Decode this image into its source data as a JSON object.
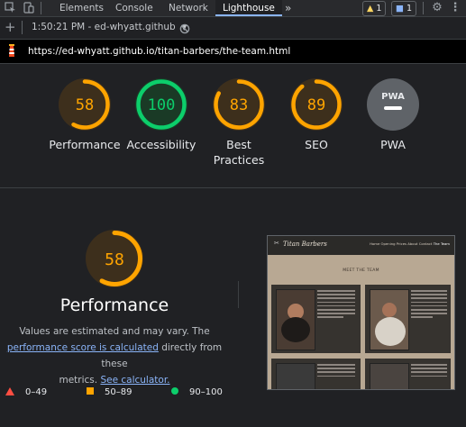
{
  "devtools": {
    "tabs": [
      "Elements",
      "Console",
      "Network",
      "Lighthouse"
    ],
    "warning_count": "1",
    "message_count": "1"
  },
  "toolbar": {
    "report_label": "1:50:21 PM - ed-whyatt.github"
  },
  "url": "https://ed-whyatt.github.io/titan-barbers/the-team.html",
  "gauges": [
    {
      "score": "58",
      "label": "Performance"
    },
    {
      "score": "100",
      "label": "Accessibility"
    },
    {
      "score": "83",
      "label": "Best Practices",
      "label_line1": "Best",
      "label_line2": "Practices"
    },
    {
      "score": "89",
      "label": "SEO"
    },
    {
      "badge": "PWA",
      "label": "PWA"
    }
  ],
  "colors": {
    "orange": "#ffa400",
    "green": "#0cce6b",
    "red": "#ff4e42",
    "gray": "#9aa0a6"
  },
  "performance": {
    "score": "58",
    "title": "Performance",
    "desc_1": "Values are estimated and may vary. The",
    "link_1": "performance score is calculated",
    "desc_2": " directly from these",
    "desc_3": "metrics. ",
    "link_2": "See calculator."
  },
  "legend": [
    {
      "range": "0–49",
      "shape": "triangle"
    },
    {
      "range": "50–89",
      "shape": "square"
    },
    {
      "range": "90–100",
      "shape": "circle"
    }
  ],
  "screenshot": {
    "brand": "Titan Barbers",
    "nav": [
      "Home",
      "Opening",
      "Prices",
      "About",
      "Contact",
      "The Team"
    ],
    "heading": "MEET THE TEAM"
  }
}
